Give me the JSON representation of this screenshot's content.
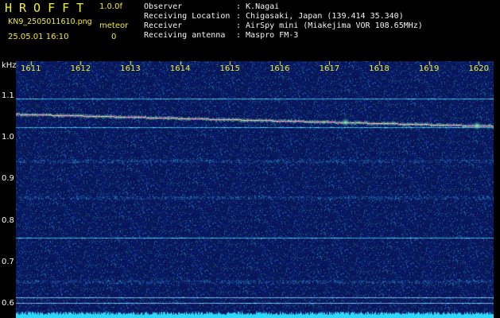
{
  "header": {
    "brand": "HROFFT",
    "version": "1.0.0f",
    "filename": "KN9_2505011610.png",
    "meteor_label": "meteor",
    "meteor_count": "0",
    "datetime": "25.05.01 16:10",
    "info": [
      {
        "label": "Observer",
        "value": ": K.Nagai"
      },
      {
        "label": "Receiving Location",
        "value": ": Chigasaki, Japan (139.414 35.340)"
      },
      {
        "label": "Receiver",
        "value": ": AirSpy mini (Miakejima VOR 108.65MHz)"
      },
      {
        "label": "Receiving antenna",
        "value": ": Maspro FM-3"
      }
    ]
  },
  "colors": {
    "header_text": "#f2ee30",
    "info_text": "#f4f4f4",
    "background": "#06125a",
    "baseline": "#2fd8ff"
  },
  "chart_data": {
    "type": "heatmap",
    "xlabel": "",
    "ylabel": "kHz",
    "x_ticks": [
      "1611",
      "1612",
      "1613",
      "1614",
      "1615",
      "1616",
      "1617",
      "1618",
      "1619",
      "1620"
    ],
    "y_ticks": [
      "1.1",
      "1.0",
      "0.9",
      "0.8",
      "0.7",
      "0.6"
    ],
    "xlim": [
      1610.7,
      1620.3
    ],
    "ylim": [
      0.566,
      1.184
    ],
    "grid": false,
    "trace": {
      "start_khz": 1.057,
      "end_khz": 1.028
    },
    "steady_lines_khz": [
      1.095,
      1.025,
      0.76,
      0.615,
      0.602
    ],
    "noise_bands_khz": [
      0.944,
      0.856,
      0.6535
    ]
  }
}
